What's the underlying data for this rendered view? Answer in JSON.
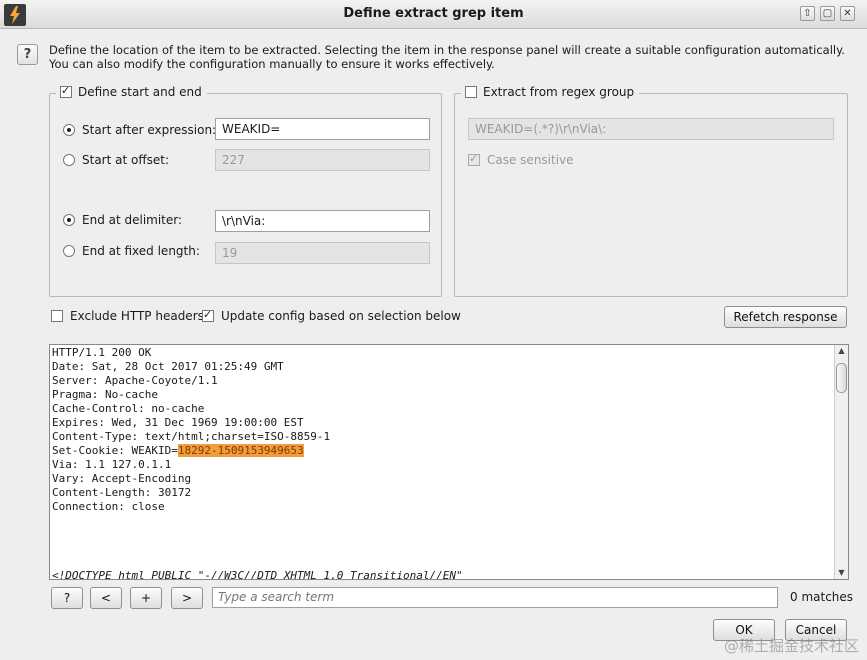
{
  "window": {
    "title": "Define extract grep item",
    "controls": [
      "⇧",
      "▢",
      "✕"
    ]
  },
  "help_label": "?",
  "description": {
    "line1": "Define the location of the item to be extracted. Selecting the item in the response panel will create a suitable configuration automatically.",
    "line2": "You can also modify the configuration manually to ensure it works effectively."
  },
  "left_group": {
    "legend": "Define start and end",
    "checked": true,
    "start_after_label": "Start after expression:",
    "start_after_value": "WEAKID=",
    "start_offset_label": "Start at offset:",
    "start_offset_value": "227",
    "end_delim_label": "End at delimiter:",
    "end_delim_value": "\\r\\nVia:",
    "end_length_label": "End at fixed length:",
    "end_length_value": "19"
  },
  "right_group": {
    "legend": "Extract from regex group",
    "checked": false,
    "regex_value": "WEAKID=(.*?)\\r\\nVia\\:",
    "case_sensitive_label": "Case sensitive"
  },
  "options": {
    "exclude_headers_label": "Exclude HTTP headers",
    "update_config_label": "Update config based on selection below",
    "refetch_label": "Refetch response"
  },
  "response": {
    "lines": [
      "HTTP/1.1 200 OK",
      "Date: Sat, 28 Oct 2017 01:25:49 GMT",
      "Server: Apache-Coyote/1.1",
      "Pragma: No-cache",
      "Cache-Control: no-cache",
      "Expires: Wed, 31 Dec 1969 19:00:00 EST",
      "Content-Type: text/html;charset=ISO-8859-1"
    ],
    "cookie_prefix": "Set-Cookie: WEAKID=",
    "cookie_highlight": "18292-1509153949653",
    "lines_after": [
      "Via: 1.1 127.0.1.1",
      "Vary: Accept-Encoding",
      "Content-Length: 30172",
      "Connection: close"
    ],
    "doctype": "<!DOCTYPE html PUBLIC \"-//W3C//DTD XHTML 1.0 Transitional//EN\""
  },
  "search": {
    "btn_help": "?",
    "btn_prev": "<",
    "btn_add": "+",
    "btn_next": ">",
    "placeholder": "Type a search term",
    "matches": "0 matches"
  },
  "footer": {
    "ok_label": "OK",
    "cancel_label": "Cancel"
  },
  "watermark": "@稀土掘金技术社区"
}
